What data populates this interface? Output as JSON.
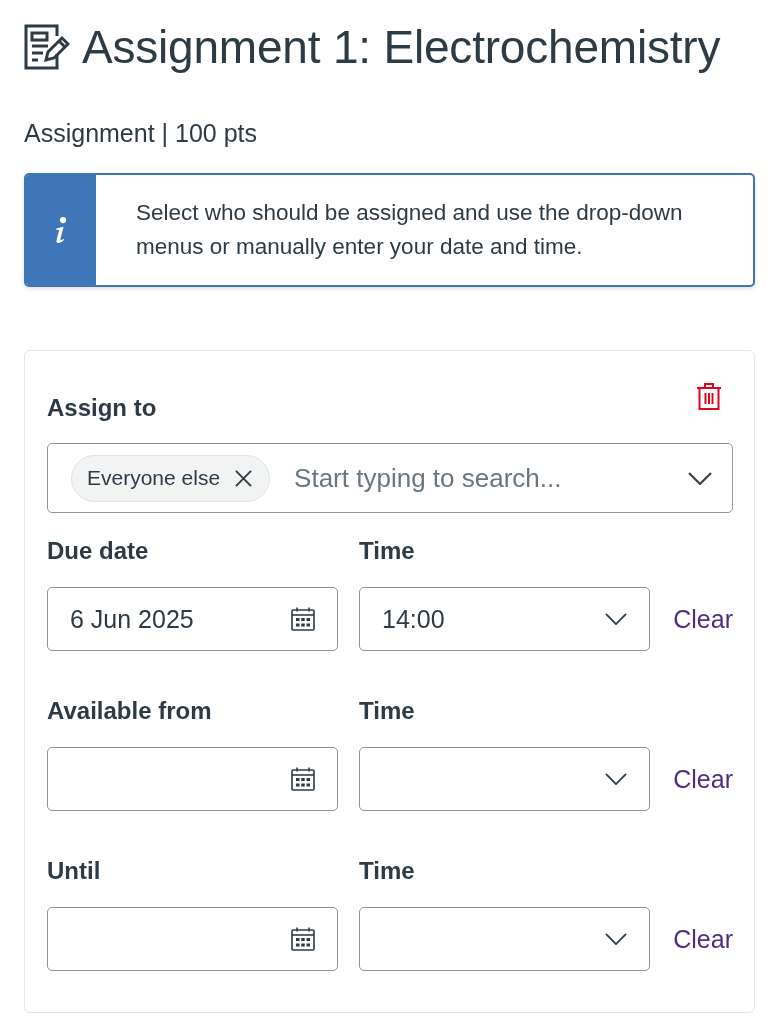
{
  "header": {
    "title": "Assignment 1: Electrochemistry",
    "subtitle": "Assignment | 100 pts"
  },
  "alert": {
    "kind": "info",
    "message": "Select who should be assigned and use the drop-down menus or manually enter your date and time."
  },
  "assign_card": {
    "assign_to": {
      "label": "Assign to",
      "chips": [
        {
          "label": "Everyone else"
        }
      ],
      "placeholder": "Start typing to search..."
    },
    "date_rows": [
      {
        "date_label": "Due date",
        "date_value": "6 Jun 2025",
        "time_label": "Time",
        "time_value": "14:00",
        "clear": "Clear"
      },
      {
        "date_label": "Available from",
        "time_label": "Time",
        "clear": "Clear"
      },
      {
        "date_label": "Until",
        "time_label": "Time",
        "clear": "Clear"
      }
    ]
  }
}
